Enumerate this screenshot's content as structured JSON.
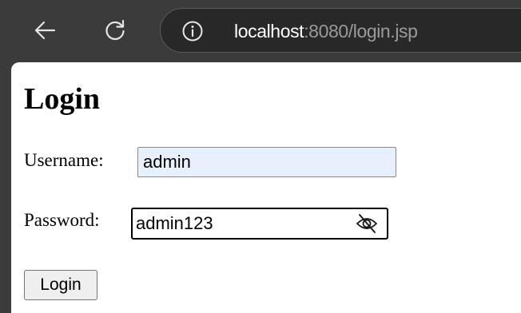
{
  "browser": {
    "url_host": "localhost",
    "url_rest": ":8080/login.jsp",
    "icons": {
      "back": "back-arrow-icon",
      "reload": "reload-icon",
      "site_info": "info-icon"
    }
  },
  "page": {
    "heading": "Login",
    "username": {
      "label": "Username:",
      "value": "admin"
    },
    "password": {
      "label": "Password:",
      "value": "admin123",
      "toggle_icon": "eye-slash-icon"
    },
    "submit_label": "Login"
  },
  "colors": {
    "toolbar_bg": "#3b3b3b",
    "autofill_bg": "#e8f0fe"
  }
}
